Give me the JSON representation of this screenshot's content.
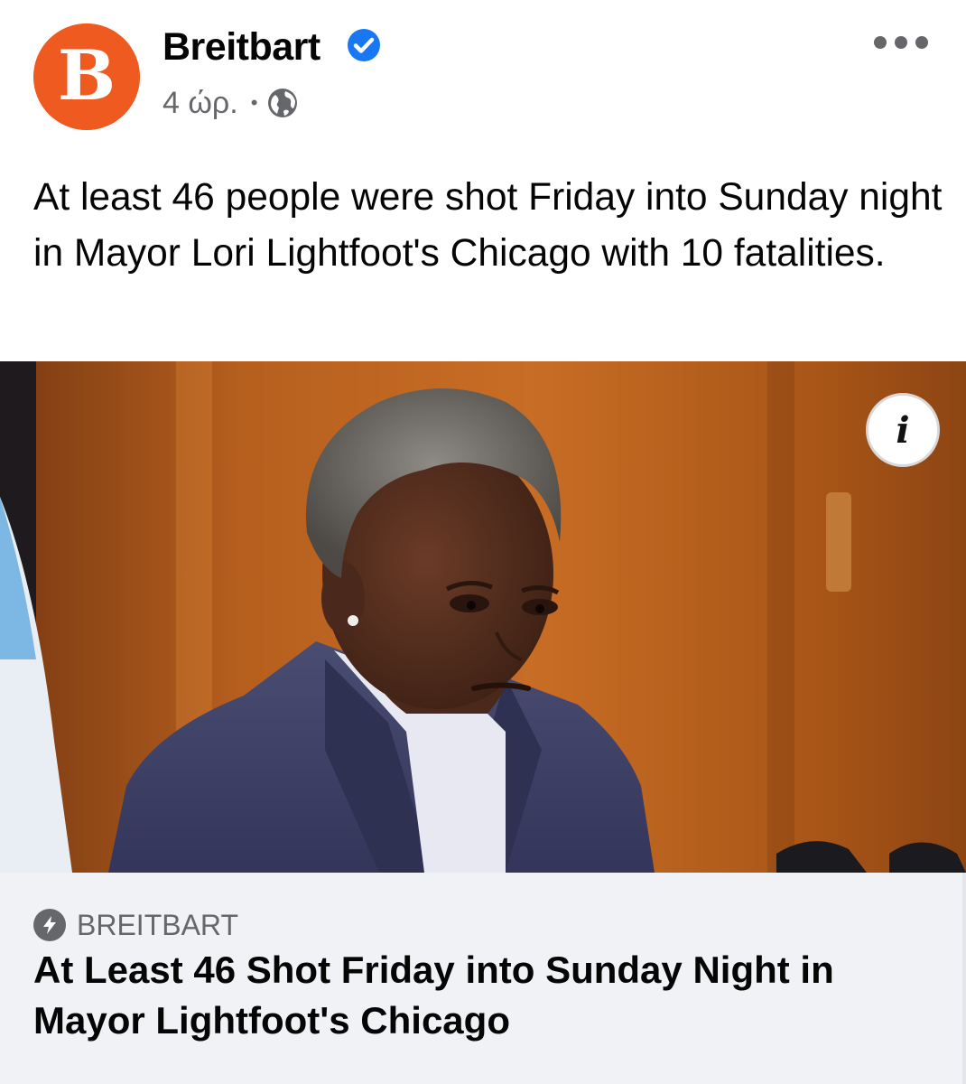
{
  "post": {
    "page_name": "Breitbart",
    "avatar_letter": "B",
    "time": "4 ώρ.",
    "separator": "•",
    "privacy_icon": "globe-icon",
    "verified_icon": "verified-badge-icon",
    "more_icon": "more-options-icon",
    "text": "At least 46 people were shot Friday into Sunday night in Mayor Lori Lightfoot's Chicago with 10 fatalities."
  },
  "media": {
    "info_label": "i"
  },
  "link": {
    "domain": "BREITBART",
    "domain_icon": "lightning-bolt-icon",
    "title": "At Least 46 Shot Friday into Sunday Night in Mayor Lightfoot's Chicago"
  },
  "colors": {
    "brand": "#ee5a1f",
    "verified": "#1877f2",
    "secondary_text": "#65676b",
    "card_bg": "#f0f2f5"
  }
}
